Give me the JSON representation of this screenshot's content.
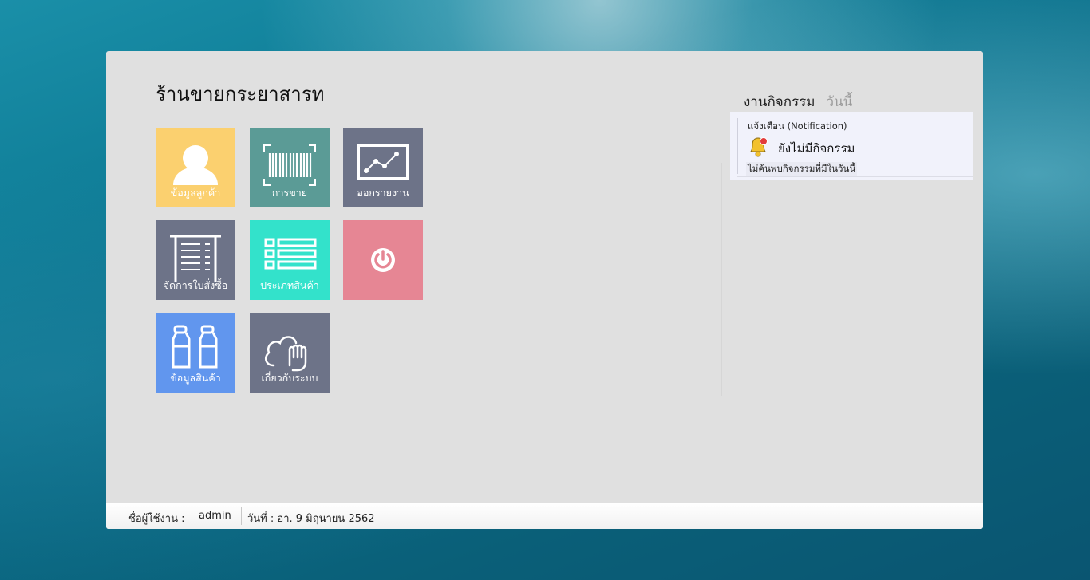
{
  "app": {
    "title": "ร้านขายกระยาสารท"
  },
  "tiles": [
    {
      "label": "ข้อมูลลูกค้า",
      "icon": "user-icon",
      "color": "#fbd06f"
    },
    {
      "label": "การขาย",
      "icon": "barcode-icon",
      "color": "#5b9b96"
    },
    {
      "label": "ออกรายงาน",
      "icon": "line-chart-icon",
      "color": "#6d7388"
    },
    {
      "label": "จัดการใบสั่งซื้อ",
      "icon": "receipt-icon",
      "color": "#6d7388"
    },
    {
      "label": "ประเภทสินค้า",
      "icon": "list-icon",
      "color": "#33e2cb"
    },
    {
      "label": "",
      "icon": "power-icon",
      "color": "#e68694"
    },
    {
      "label": "ข้อมูลสินค้า",
      "icon": "bottles-icon",
      "color": "#6196ee"
    },
    {
      "label": "เกี่ยวกับระบบ",
      "icon": "cloud-hand-icon",
      "color": "#6d7388"
    }
  ],
  "activity": {
    "title": "งานกิจกรรม",
    "today": "วันนี้",
    "notification": {
      "heading": "แจ้งเตือน (Notification)",
      "empty": "ยังไม่มีกิจกรรม",
      "detail": "ไม่ค้นพบกิจกรรมที่มีในวันนี้"
    }
  },
  "status": {
    "user_label": "ชื่อผู้ใช้งาน :",
    "user_value": "admin",
    "date": "วันที่ : อา. 9 มิถุนายน 2562"
  }
}
